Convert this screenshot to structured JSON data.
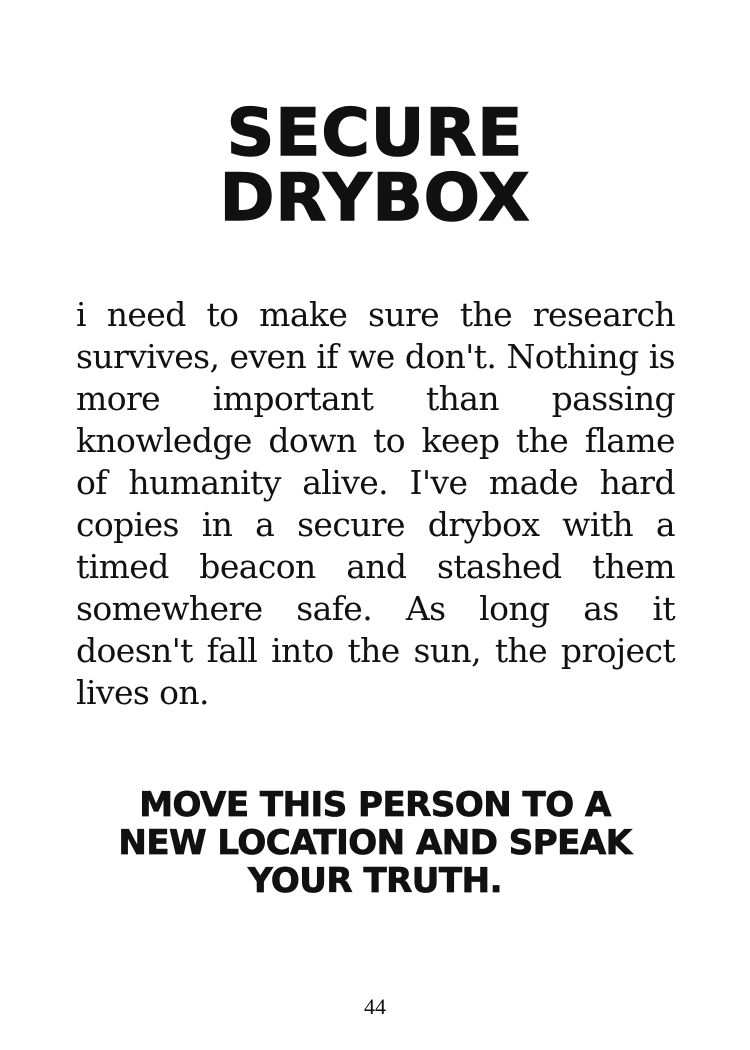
{
  "card": {
    "title_lines": [
      "SECURE",
      "DRYBOX"
    ],
    "body": "i need to make sure the research survives, even if we don't. Nothing is more important than passing knowledge down to keep the flame of humanity alive. I've made hard copies in a secure drybox with a timed beacon and stashed them somewhere safe. As long as it doesn't fall into the sun, the project lives on.",
    "instruction_lines": [
      "MOVE THIS PERSON TO A",
      "NEW LOCATION AND SPEAK",
      "YOUR TRUTH."
    ],
    "page_number": "44"
  }
}
